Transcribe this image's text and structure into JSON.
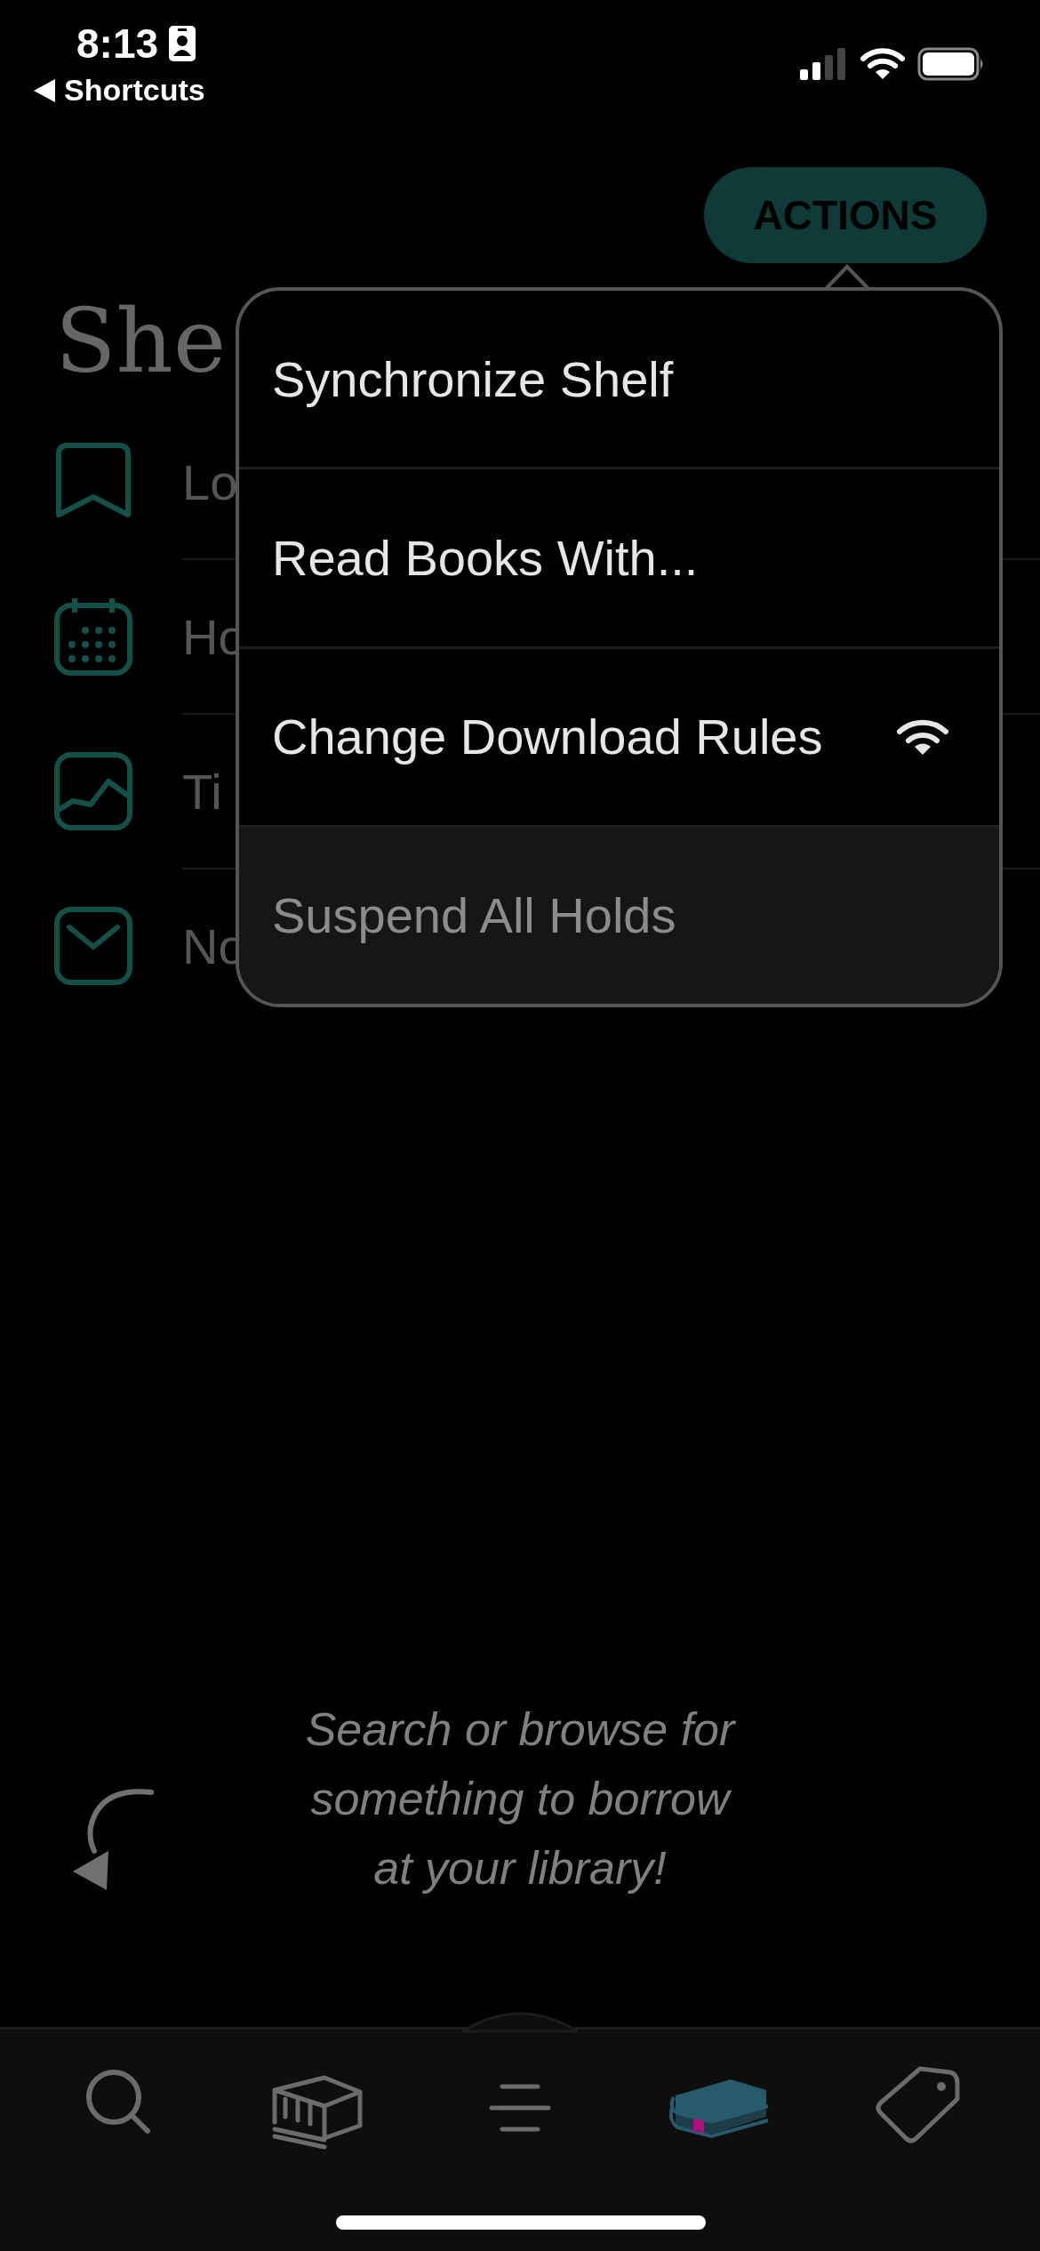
{
  "status_bar": {
    "time": "8:13",
    "back_label": "Shortcuts"
  },
  "header": {
    "actions_button": "ACTIONS"
  },
  "title": "She",
  "list": [
    {
      "kind": "bookmark",
      "label": "Lo"
    },
    {
      "kind": "calendar",
      "label": "Ho"
    },
    {
      "kind": "chart",
      "label": "Ti"
    },
    {
      "kind": "envelope",
      "label": "No"
    }
  ],
  "menu": [
    {
      "label": "Synchronize Shelf",
      "kind": "plain",
      "disabled": false
    },
    {
      "label": "Read Books With...",
      "kind": "plain",
      "disabled": false
    },
    {
      "label": "Change Download Rules",
      "kind": "wifi",
      "disabled": false
    },
    {
      "label": "Suspend All Holds",
      "kind": "plain",
      "disabled": true
    }
  ],
  "empty_message": [
    "Search or browse for",
    "something to borrow",
    "at your library!"
  ],
  "tabs": [
    {
      "kind": "search",
      "selected": false
    },
    {
      "kind": "library",
      "selected": false
    },
    {
      "kind": "menu",
      "selected": false
    },
    {
      "kind": "shelf",
      "selected": true
    },
    {
      "kind": "tag",
      "selected": false
    }
  ]
}
